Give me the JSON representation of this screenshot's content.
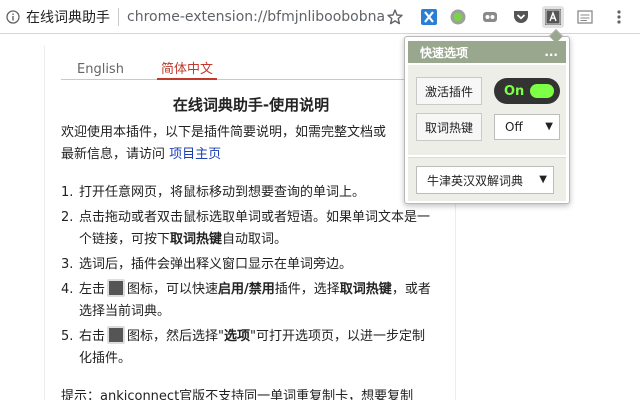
{
  "browser": {
    "site_name": "在线词典助手",
    "url": "chrome-extension://bfmjnliboobobna"
  },
  "tabs": [
    "English",
    "简体中文"
  ],
  "page": {
    "title": "在线词典助手-使用说明",
    "intro_text": "欢迎使用本插件，以下是插件简要说明，如需完整文档或",
    "intro_text2": "最新信息，请访问",
    "intro_link": "项目主页",
    "steps": [
      {
        "num": "1.",
        "parts": [
          "打开任意网页，将鼠标移动到想要查询的单词上。"
        ]
      },
      {
        "num": "2.",
        "parts": [
          "点击拖动或者双击鼠标选取单词或者短语。如果单词文本是一个链接，可按下",
          "取词热键",
          "自动取词。"
        ]
      },
      {
        "num": "3.",
        "parts": [
          "选词后，插件会弹出释义窗口显示在单词旁边。"
        ]
      },
      {
        "num": "4.",
        "parts": [
          "左击",
          "图标，可以快速",
          "启用/禁用",
          "插件，选择",
          "取词热键",
          "，或者选择当前词典。"
        ]
      },
      {
        "num": "5.",
        "parts": [
          "右击",
          "图标，然后选择\"",
          "选项",
          "\"可打开选项页，以进一步定制化插件。"
        ]
      }
    ],
    "note": "提示：ankiconnect官版不支持同一单词重复制卡，想要复制"
  },
  "popup": {
    "header_title": "快速选项",
    "menu": "...",
    "activate_label": "激活插件",
    "toggle_state": "On",
    "hotkey_label": "取词热键",
    "hotkey_value": "Off",
    "dictionary": "牛津英汉双解词典",
    "accent_color": "#9aa78f",
    "toggle_color": "#7cff45"
  }
}
